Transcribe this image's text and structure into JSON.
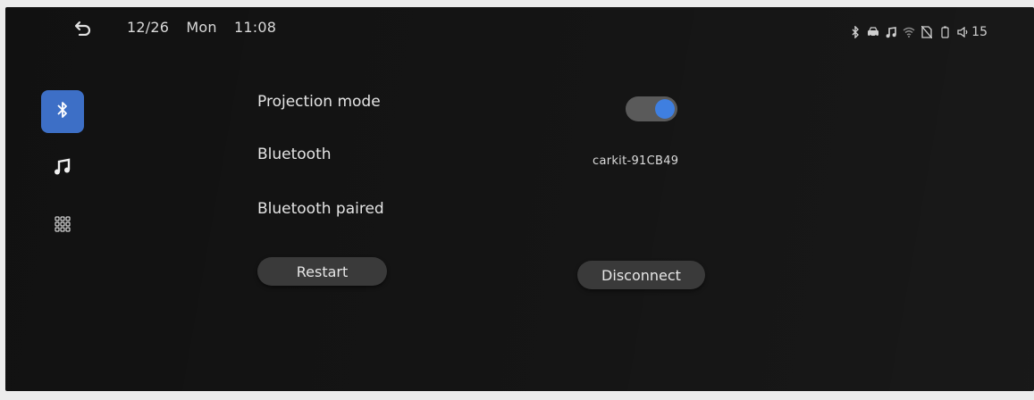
{
  "status_bar": {
    "date": "12/26",
    "weekday": "Mon",
    "time": "11:08",
    "volume_level": "15",
    "icons": [
      "back-icon",
      "bluetooth-status-icon",
      "car-icon",
      "music-status-icon",
      "wifi-icon",
      "sim-off-icon",
      "battery-icon",
      "volume-icon"
    ]
  },
  "sidebar": {
    "items": [
      {
        "name": "bluetooth",
        "icon": "bluetooth-icon",
        "active": true
      },
      {
        "name": "music",
        "icon": "music-note-icon",
        "active": false
      },
      {
        "name": "apps",
        "icon": "grid-icon",
        "active": false
      }
    ]
  },
  "settings": {
    "projection_mode_label": "Projection mode",
    "projection_mode_on": true,
    "bluetooth_label": "Bluetooth",
    "bluetooth_device": "carkit-91CB49",
    "paired_label": "Bluetooth paired"
  },
  "actions": {
    "restart_label": "Restart",
    "disconnect_label": "Disconnect"
  },
  "colors": {
    "accent": "#3f7fe0",
    "sidebar_active": "#3d6fc6",
    "background": "#141414",
    "button": "#3a3a3a"
  }
}
